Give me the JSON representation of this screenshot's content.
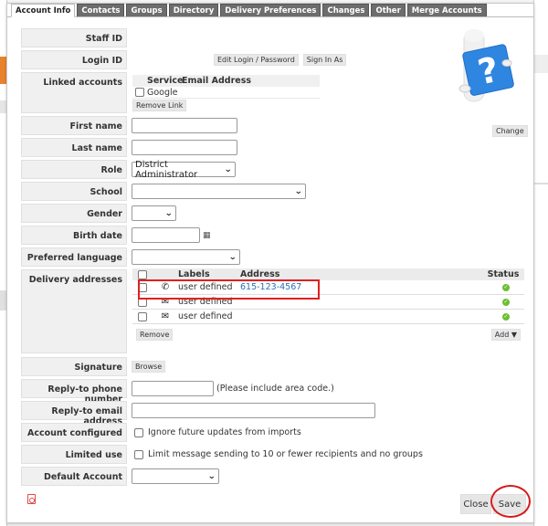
{
  "tabs": [
    {
      "label": "Account Info",
      "active": true
    },
    {
      "label": "Contacts",
      "active": false
    },
    {
      "label": "Groups",
      "active": false
    },
    {
      "label": "Directory",
      "active": false
    },
    {
      "label": "Delivery Preferences",
      "active": false
    },
    {
      "label": "Changes",
      "active": false
    },
    {
      "label": "Other",
      "active": false
    },
    {
      "label": "Merge Accounts",
      "active": false
    }
  ],
  "fields": {
    "staff_id": {
      "label": "Staff ID",
      "value": ""
    },
    "login_id": {
      "label": "Login ID",
      "value": "",
      "edit_button": "Edit Login / Password",
      "sign_in_button": "Sign In As"
    },
    "linked_accounts": {
      "label": "Linked accounts",
      "columns": [
        "Service",
        "Email Address"
      ],
      "rows": [
        {
          "service": "Google",
          "email": ""
        }
      ],
      "remove_button": "Remove Link"
    },
    "first_name": {
      "label": "First name",
      "value": ""
    },
    "last_name": {
      "label": "Last name",
      "value": ""
    },
    "role": {
      "label": "Role",
      "value": "District Administrator"
    },
    "school": {
      "label": "School",
      "value": ""
    },
    "gender": {
      "label": "Gender",
      "value": ""
    },
    "birth_date": {
      "label": "Birth date",
      "value": "",
      "icon": "calendar-icon"
    },
    "preferred_language": {
      "label": "Preferred language",
      "value": ""
    },
    "delivery_addresses": {
      "label": "Delivery addresses",
      "columns": {
        "labels": "Labels",
        "address": "Address",
        "status": "Status"
      },
      "rows": [
        {
          "type": "phone-icon",
          "label": "user defined",
          "address": "615-123-4567",
          "status": "ok"
        },
        {
          "type": "envelope-icon",
          "label": "user defined",
          "address": "",
          "status": "ok"
        },
        {
          "type": "envelope-icon",
          "label": "user defined",
          "address": "",
          "status": "ok"
        }
      ],
      "remove_button": "Remove",
      "add_button": "Add"
    },
    "signature": {
      "label": "Signature",
      "browse_button": "Browse"
    },
    "reply_phone": {
      "label": "Reply-to phone number",
      "value": "",
      "hint": "(Please include area code.)"
    },
    "reply_email": {
      "label": "Reply-to email address",
      "value": ""
    },
    "account_configured": {
      "label": "Account configured",
      "checkbox_label": "Ignore future updates from imports",
      "checked": false
    },
    "limited_use": {
      "label": "Limited use",
      "checkbox_label": "Limit message sending to 10 or fewer recipients and no groups",
      "checked": false
    },
    "default_account": {
      "label": "Default Account",
      "value": ""
    }
  },
  "avatar": {
    "change_button": "Change"
  },
  "footer": {
    "close_button": "Close",
    "save_button": "Save"
  },
  "colors": {
    "highlight": "#e02020",
    "link": "#2a6fb5",
    "status_ok": "#6abf2f",
    "tab_inactive": "#6d6d6d"
  }
}
